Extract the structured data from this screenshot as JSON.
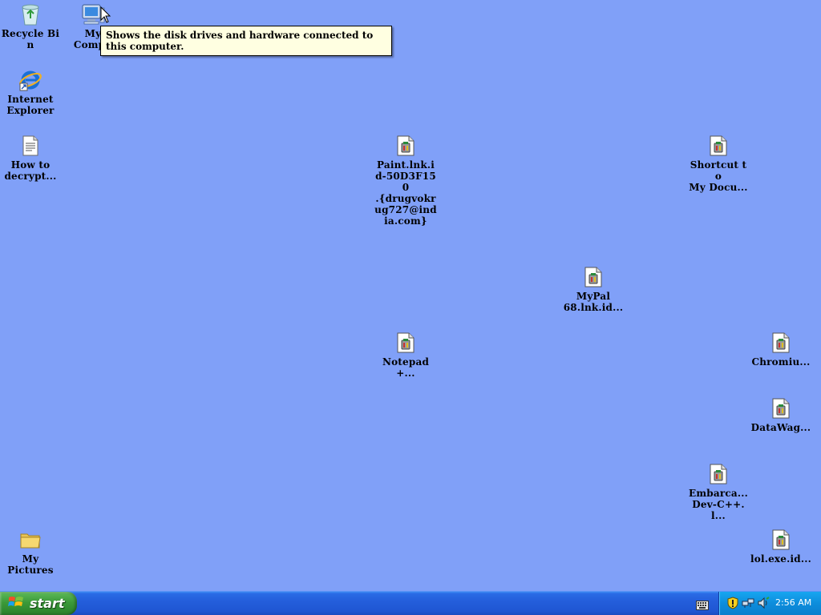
{
  "desktop": {
    "background_color": "#80a0f8",
    "icons": [
      {
        "id": "recycle-bin",
        "label": "Recycle Bin",
        "icon": "recycle-bin-icon"
      },
      {
        "id": "my-computer",
        "label": "My\nCompu",
        "icon": "my-computer-icon"
      },
      {
        "id": "internet-explorer",
        "label": "Internet\nExplorer",
        "icon": "internet-explorer-icon"
      },
      {
        "id": "how-to-decrypt",
        "label": "How to\ndecrypt...",
        "icon": "text-document-icon"
      },
      {
        "id": "paint-lnk",
        "label": "Paint.lnk.i\nd-50D3F150\n.{drugvokr\nug727@ind\nia.com}",
        "icon": "encrypted-file-icon"
      },
      {
        "id": "shortcut-my-docu",
        "label": "Shortcut to\nMy Docu...",
        "icon": "encrypted-file-icon"
      },
      {
        "id": "mypal",
        "label": "MyPal\n68.lnk.id...",
        "icon": "encrypted-file-icon"
      },
      {
        "id": "notepad",
        "label": "Notepad+...",
        "icon": "encrypted-file-icon"
      },
      {
        "id": "chromium",
        "label": "Chromiu...",
        "icon": "encrypted-file-icon"
      },
      {
        "id": "datawag",
        "label": "DataWag...",
        "icon": "encrypted-file-icon"
      },
      {
        "id": "embarca",
        "label": "Embarca...\nDev-C++.l...",
        "icon": "encrypted-file-icon"
      },
      {
        "id": "my-pictures",
        "label": "My\nPictures",
        "icon": "folder-icon"
      },
      {
        "id": "lol-exe",
        "label": "lol.exe.id...",
        "icon": "encrypted-file-icon"
      }
    ]
  },
  "tooltip": {
    "text": "Shows the disk drives and hardware connected to this computer."
  },
  "taskbar": {
    "start_label": "start",
    "clock": "2:56 AM",
    "tray_icons": [
      "security-shield-icon",
      "network-icon",
      "volume-icon"
    ]
  }
}
